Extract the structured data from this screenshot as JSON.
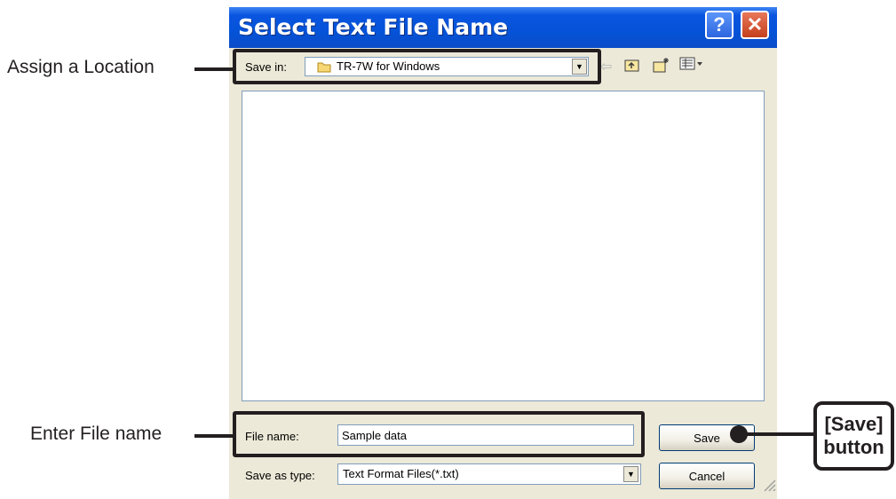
{
  "dialog": {
    "title": "Select Text File Name",
    "help_label": "?",
    "close_label": "✕"
  },
  "toolbar": {
    "save_in_label": "Save in:",
    "save_in_value": "TR-7W for Windows",
    "icons": [
      "folder-icon",
      "back-arrow-icon",
      "up-folder-icon",
      "new-folder-icon",
      "views-menu-icon"
    ]
  },
  "form": {
    "file_name_label": "File name:",
    "file_name_value": "Sample data",
    "save_as_type_label": "Save as type:",
    "save_as_type_value": "Text Format Files(*.txt)",
    "save_button": "Save",
    "cancel_button": "Cancel"
  },
  "annotations": {
    "location": "Assign a Location",
    "file_name": "Enter File name",
    "save_line1": "[Save]",
    "save_line2": "button"
  },
  "colors": {
    "title_bar": "#0553d8",
    "dialog_bg": "#ece9d8",
    "annotation": "#231f20"
  }
}
